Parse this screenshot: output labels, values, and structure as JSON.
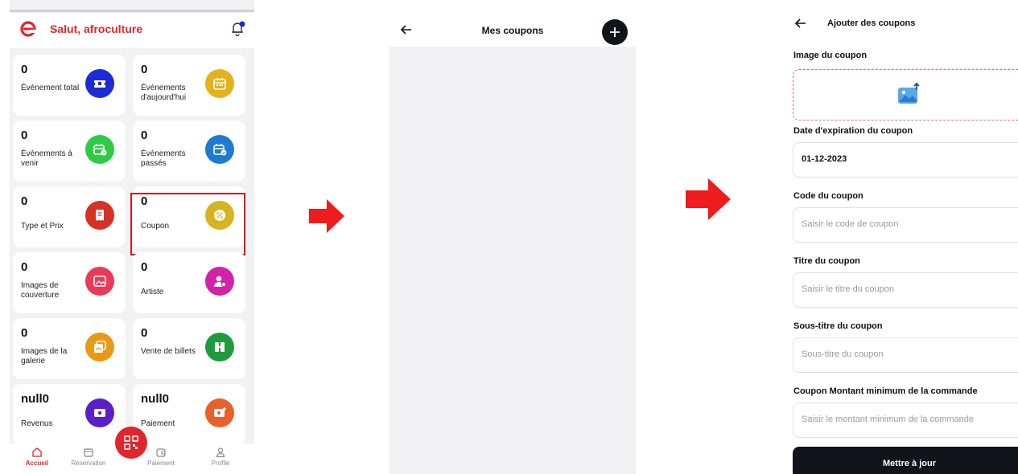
{
  "dashboard": {
    "greeting": "Salut, afroculture",
    "cards": [
      {
        "value": "0",
        "label": "Événement total",
        "color": "#1c2bd6",
        "icon": "ticket-icon"
      },
      {
        "value": "0",
        "label": "Événements d'aujourd'hui",
        "color": "#e3b21c",
        "icon": "calendar-icon"
      },
      {
        "value": "0",
        "label": "Évènements à venir",
        "color": "#2ecb46",
        "icon": "calendar-clock-icon"
      },
      {
        "value": "0",
        "label": "Événements passés",
        "color": "#1f7ad0",
        "icon": "calendar-check-icon"
      },
      {
        "value": "0",
        "label": "Type et Prix",
        "color": "#d73024",
        "icon": "receipt-icon"
      },
      {
        "value": "0",
        "label": "Coupon",
        "color": "#d6b321",
        "icon": "coupon-icon"
      },
      {
        "value": "0",
        "label": "Images de couverture",
        "color": "#ea3a57",
        "icon": "image-icon"
      },
      {
        "value": "0",
        "label": "Artiste",
        "color": "#d321a8",
        "icon": "artist-icon"
      },
      {
        "value": "0",
        "label": "Images de la galerie",
        "color": "#e69a16",
        "icon": "gallery-icon"
      },
      {
        "value": "0",
        "label": "Vente de billets",
        "color": "#1f9b3d",
        "icon": "ticket-sale-icon"
      },
      {
        "value": "null0",
        "label": "Revenus",
        "color": "#5a1fc8",
        "icon": "wallet-icon"
      },
      {
        "value": "null0",
        "label": "Paiement",
        "color": "#e8602b",
        "icon": "payment-icon"
      }
    ],
    "nav": {
      "accueil": "Accueil",
      "reservation": "Réservation",
      "paiement": "Paiement",
      "profile": "Profile"
    }
  },
  "coupons_list": {
    "title": "Mes coupons"
  },
  "add_coupon": {
    "title": "Ajouter des coupons",
    "image_label": "Image du coupon",
    "expiry_label": "Date d'expiration du coupon",
    "expiry_value": "01-12-2023",
    "code_label": "Code du coupon",
    "code_placeholder": "Saisir le code de coupon",
    "title_label": "Titre du coupon",
    "title_placeholder": "Saisir le titre du coupon",
    "subtitle_label": "Sous-titre du coupon",
    "subtitle_placeholder": "Sous-titre du coupon",
    "min_label": "Coupon Montant minimum de la commande",
    "min_placeholder": "Saisir le montant minimum de la commande",
    "submit": "Mettre à jour"
  }
}
